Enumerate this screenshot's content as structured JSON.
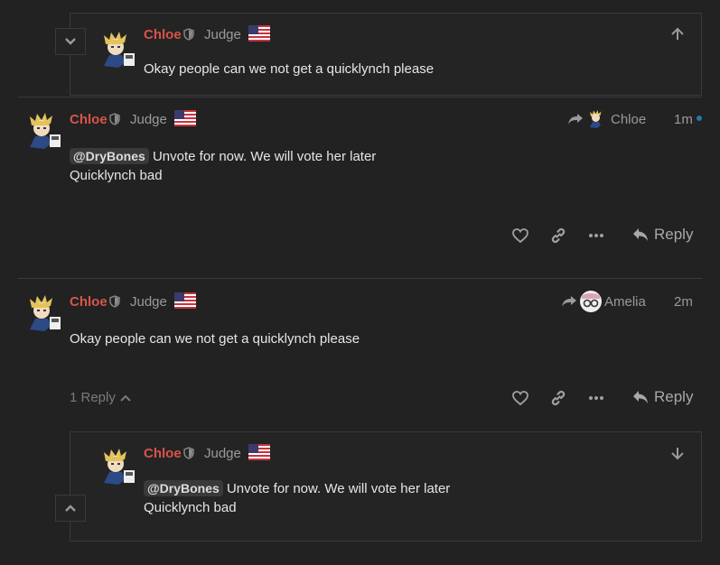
{
  "colors": {
    "background": "#222222",
    "username": "#d9534a",
    "muted": "#9a9a9a",
    "border": "#3a3a3a",
    "unread_dot": "#1e7aa6"
  },
  "embed_top": {
    "username": "Chloe",
    "title": "Judge",
    "text": "Okay people can we not get a quicklynch please",
    "icons": [
      "chevron-down-icon",
      "arrow-up-icon",
      "shield-icon",
      "us-flag-icon"
    ]
  },
  "post1": {
    "username": "Chloe",
    "title": "Judge",
    "reply_to_name": "Chloe",
    "time": "1m",
    "mention": "@DryBones",
    "line1": "Unvote for now. We will vote her later",
    "line2": "Quicklynch bad",
    "reply_label": "Reply",
    "icons": [
      "heart-icon",
      "link-icon",
      "more-icon",
      "reply-arrow-icon"
    ]
  },
  "post2": {
    "username": "Chloe",
    "title": "Judge",
    "reply_to_name": "Amelia",
    "time": "2m",
    "text": "Okay people can we not get a quicklynch please",
    "replies_label": "1 Reply",
    "reply_label": "Reply",
    "icons": [
      "heart-icon",
      "link-icon",
      "more-icon",
      "reply-arrow-icon"
    ]
  },
  "embed_bottom": {
    "username": "Chloe",
    "title": "Judge",
    "mention": "@DryBones",
    "line1": "Unvote for now. We will vote her later",
    "line2": "Quicklynch bad",
    "icons": [
      "chevron-up-icon",
      "arrow-down-icon"
    ]
  }
}
